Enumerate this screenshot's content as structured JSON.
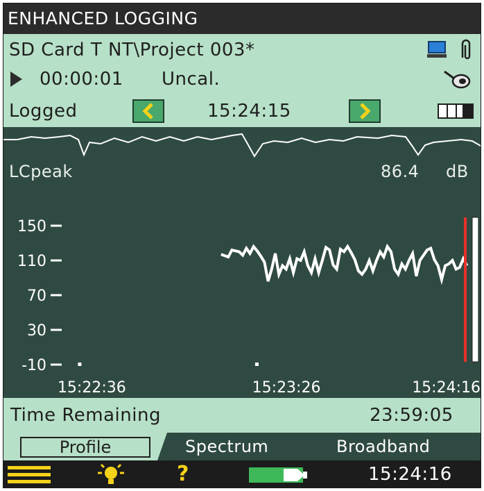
{
  "title": "ENHANCED LOGGING",
  "info": {
    "project_path": "SD Card T NT\\Project 003*",
    "elapsed": "00:00:01",
    "cal_status": "Uncal.",
    "mode_label": "Logged",
    "cursor_time": "15:24:15"
  },
  "plot": {
    "parameter": "LCpeak",
    "value": "86.4",
    "unit": "dB"
  },
  "chart_data": {
    "type": "line",
    "ylim": [
      -10,
      150
    ],
    "y_ticks": [
      "150",
      "110",
      "70",
      "30",
      "-10"
    ],
    "y_tick_values": [
      150,
      110,
      70,
      30,
      -10
    ],
    "x_tick_labels": [
      "15:22:36",
      "15:23:26",
      "15:24:16"
    ],
    "x_tick_seconds": [
      0,
      50,
      100
    ],
    "xlim_seconds": [
      -11,
      101
    ],
    "series": [
      {
        "x_seconds": [
          30,
          32,
          33,
          35,
          36,
          37,
          38,
          39,
          40,
          41,
          42,
          43,
          44,
          45,
          46,
          47,
          48,
          49,
          50,
          51,
          52,
          53,
          54,
          55,
          56,
          57,
          58,
          59,
          60,
          61,
          62,
          63,
          64,
          65,
          66,
          67,
          68,
          69,
          70,
          71,
          72,
          73,
          74,
          75,
          76,
          77,
          78,
          79,
          80,
          81,
          82,
          83,
          84,
          85,
          86,
          87,
          88,
          89,
          90,
          91,
          92,
          93,
          94,
          95,
          96,
          97,
          98
        ],
        "y": [
          117,
          114,
          122,
          120,
          116,
          124,
          118,
          126,
          121,
          115,
          108,
          86,
          100,
          118,
          94,
          104,
          100,
          112,
          96,
          112,
          110,
          120,
          104,
          96,
          112,
          96,
          110,
          125,
          122,
          105,
          100,
          123,
          120,
          126,
          119,
          111,
          98,
          94,
          100,
          110,
          98,
          110,
          120,
          114,
          126,
          120,
          100,
          94,
          106,
          100,
          110,
          118,
          92,
          110,
          116,
          122,
          124,
          111,
          104,
          88,
          104,
          106,
          110,
          100,
          102,
          112,
          104
        ],
        "color": "#ffffff"
      }
    ],
    "dots_seconds": [
      -9,
      40
    ]
  },
  "status": {
    "label": "Time Remaining",
    "value": "23:59:05"
  },
  "tabs": {
    "profile": "Profile",
    "spectrum": "Spectrum",
    "broadband": "Broadband"
  },
  "bottom": {
    "clock": "15:24:16",
    "help_glyph": "?"
  },
  "icons": {
    "menu": "menu-icon",
    "backlight": "backlight-bulb-icon",
    "help": "help-icon",
    "battery": "battery-icon",
    "play": "play-icon",
    "computer": "computer-icon",
    "paperclip": "paperclip-icon",
    "microphone": "microphone-icon",
    "prev": "chevron-left-icon",
    "next": "chevron-right-icon",
    "levels": "level-bars-icon"
  },
  "colors": {
    "panel": "#b6e0c7",
    "plot_bg": "#2f4a42",
    "nav_button": "#49a86b",
    "cursor_red": "#e8302a",
    "accent_yellow": "#f5d21a"
  }
}
